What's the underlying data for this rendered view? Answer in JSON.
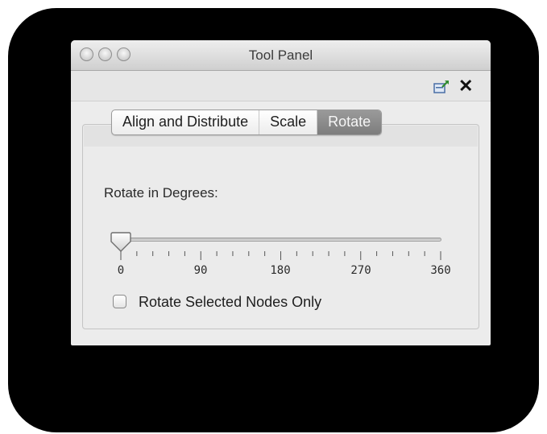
{
  "window": {
    "title": "Tool Panel"
  },
  "toolbar": {
    "detach_icon": "detach-icon",
    "close_icon": "close-icon",
    "close_glyph": "✕"
  },
  "tabs": [
    {
      "label": "Align and Distribute",
      "active": false
    },
    {
      "label": "Scale",
      "active": false
    },
    {
      "label": "Rotate",
      "active": true
    }
  ],
  "rotate": {
    "label": "Rotate in Degrees:",
    "value": 0,
    "min": 0,
    "max": 360,
    "tick_labels": [
      "0",
      "90",
      "180",
      "270",
      "360"
    ],
    "checkbox_label": "Rotate Selected Nodes Only",
    "checkbox_checked": false
  }
}
